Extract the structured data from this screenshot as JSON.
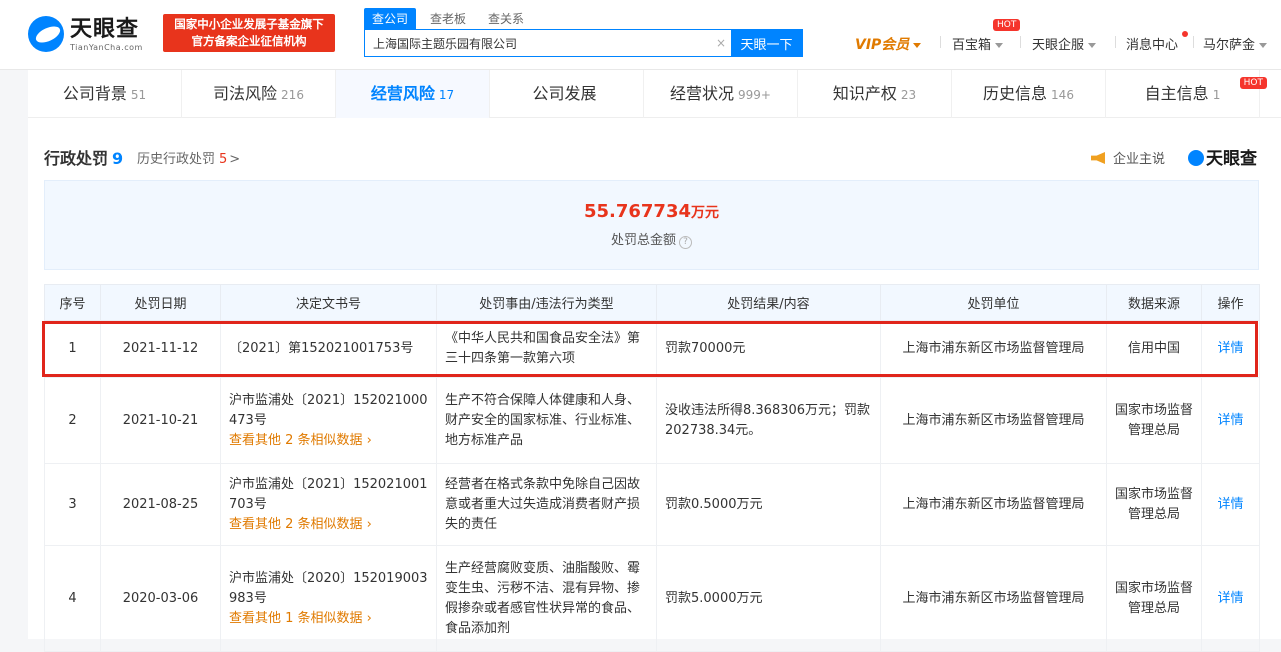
{
  "header": {
    "logo_cn": "天眼查",
    "logo_en": "TianYanCha.com",
    "slogan_line1": "国家中小企业发展子基金旗下",
    "slogan_line2": "官方备案企业征信机构",
    "search_tabs": [
      "查公司",
      "查老板",
      "查关系"
    ],
    "search_value": "上海国际主题乐园有限公司",
    "search_clear": "×",
    "search_button": "天眼一下",
    "vip": "VIP会员",
    "baobaoxiang": "百宝箱",
    "hot": "HOT",
    "qifu": "天眼企服",
    "messages": "消息中心",
    "user": "马尔萨金"
  },
  "tabs": [
    {
      "label": "公司背景",
      "count": "51"
    },
    {
      "label": "司法风险",
      "count": "216"
    },
    {
      "label": "经营风险",
      "count": "17"
    },
    {
      "label": "公司发展",
      "count": ""
    },
    {
      "label": "经营状况",
      "count": "999+"
    },
    {
      "label": "知识产权",
      "count": "23"
    },
    {
      "label": "历史信息",
      "count": "146"
    },
    {
      "label": "自主信息",
      "count": "1"
    }
  ],
  "section": {
    "title": "行政处罚",
    "count": "9",
    "history_label": "历史行政处罚",
    "history_count": "5",
    "history_arrow": ">",
    "promo": "企业主说",
    "brand": "天眼查"
  },
  "summary": {
    "amount": "55.767734",
    "unit": "万元",
    "label": "处罚总金额",
    "help": "?"
  },
  "table": {
    "headers": [
      "序号",
      "处罚日期",
      "决定文书号",
      "处罚事由/违法行为类型",
      "处罚结果/内容",
      "处罚单位",
      "数据来源",
      "操作"
    ],
    "rows": [
      {
        "no": "1",
        "date": "2021-11-12",
        "doc": "〔2021〕第152021001753号",
        "similar": "",
        "reason": "《中华人民共和国食品安全法》第三十四条第一款第六项",
        "result": "罚款70000元",
        "unit": "上海市浦东新区市场监督管理局",
        "source": "信用中国",
        "action": "详情"
      },
      {
        "no": "2",
        "date": "2021-10-21",
        "doc": "沪市监浦处〔2021〕152021000473号",
        "similar": "查看其他 2 条相似数据 ›",
        "reason": "生产不符合保障人体健康和人身、财产安全的国家标准、行业标准、地方标准产品",
        "result": "没收违法所得8.368306万元；罚款202738.34元。",
        "unit": "上海市浦东新区市场监督管理局",
        "source": "国家市场监督管理总局",
        "action": "详情"
      },
      {
        "no": "3",
        "date": "2021-08-25",
        "doc": "沪市监浦处〔2021〕152021001703号",
        "similar": "查看其他 2 条相似数据 ›",
        "reason": "经营者在格式条款中免除自己因故意或者重大过失造成消费者财产损失的责任",
        "result": "罚款0.5000万元",
        "unit": "上海市浦东新区市场监督管理局",
        "source": "国家市场监督管理总局",
        "action": "详情"
      },
      {
        "no": "4",
        "date": "2020-03-06",
        "doc": "沪市监浦处〔2020〕152019003983号",
        "similar": "查看其他 1 条相似数据 ›",
        "reason": "生产经营腐败变质、油脂酸败、霉变生虫、污秽不洁、混有异物、掺假掺杂或者感官性状异常的食品、食品添加剂",
        "result": "罚款5.0000万元",
        "unit": "上海市浦东新区市场监督管理局",
        "source": "国家市场监督管理总局",
        "action": "详情"
      }
    ]
  }
}
